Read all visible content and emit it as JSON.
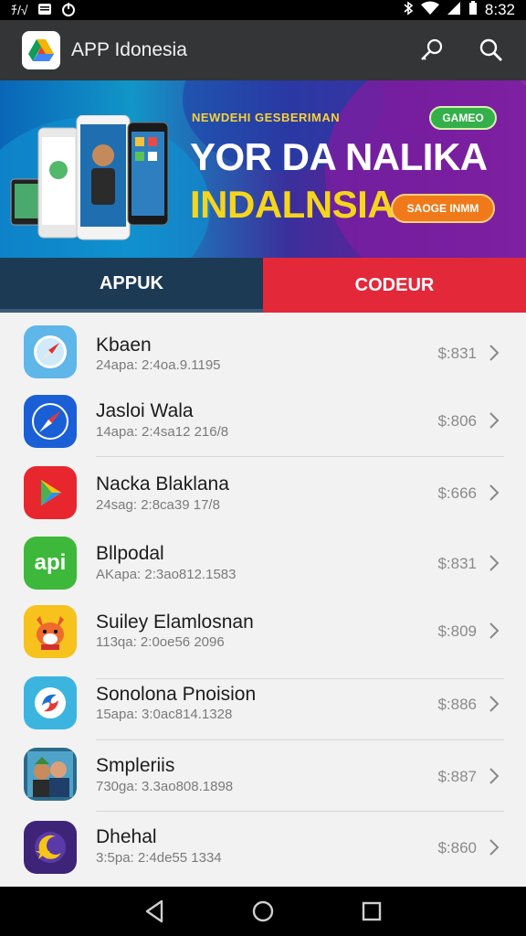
{
  "status_bar": {
    "time": "8:32",
    "left_text": "ﾁ/√"
  },
  "app_bar": {
    "title": "APP Idonesia",
    "logo_icon": "google-drive-triangle-icon",
    "actions": [
      "key-search-icon",
      "search-icon"
    ]
  },
  "banner": {
    "eyebrow": "NEWDEHI GESBERIMAN",
    "headline_line1": "YOR DA NALIKA",
    "headline_line2": "INDALNSIA",
    "green_pill": "GAMEO",
    "cta": "SAOGE INMM"
  },
  "tabs": [
    {
      "label": "APPUK",
      "active": true
    },
    {
      "label": "CODEUR",
      "active": false
    }
  ],
  "apps": [
    {
      "name": "Kbaen",
      "sub": "24apa: 2:4oa.9.1195",
      "price": "$:831",
      "icon": "compass-icon",
      "color": "#5fb6e8"
    },
    {
      "name": "Jasloi Wala",
      "sub": "14apa: 2:4sa12 216/8",
      "price": "$:806",
      "icon": "compass-needle-icon",
      "color": "#1a5fd6"
    },
    {
      "name": "Nacka Blaklana",
      "sub": "24sag: 2:8ca39 17/8",
      "price": "$:666",
      "icon": "play-store-icon",
      "color": "#e8262e"
    },
    {
      "name": "Bllpodal",
      "sub": "AKapa: 2:3ao812.1583",
      "price": "$:831",
      "icon": "api-icon",
      "color": "#3db83a"
    },
    {
      "name": "Suiley Elamlosnan",
      "sub": "113qa: 2:0oe56 2096",
      "price": "$:809",
      "icon": "fox-mascot-icon",
      "color": "#f7c21c"
    },
    {
      "name": "Sonolona Pnoision",
      "sub": "15apa: 3:0ac814.1328",
      "price": "$:886",
      "icon": "swirl-logo-icon",
      "color": "#3cb4e0"
    },
    {
      "name": "Smpleriis",
      "sub": "730ga: 3.3ao808.1898",
      "price": "$:887",
      "icon": "characters-game-icon",
      "color": "#2a6a8a"
    },
    {
      "name": "Dhehal",
      "sub": "3:5pa: 2:4de55 1334",
      "price": "$:860",
      "icon": "star-moon-icon",
      "color": "#3d2478"
    }
  ],
  "nav": [
    "back-icon",
    "home-icon",
    "recents-icon"
  ]
}
